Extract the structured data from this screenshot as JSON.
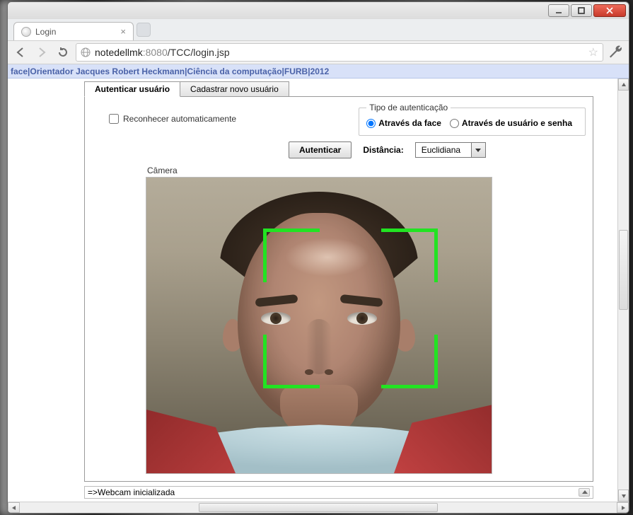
{
  "window": {
    "minimize_tooltip": "Minimize",
    "maximize_tooltip": "Maximize",
    "close_tooltip": "Close"
  },
  "browser": {
    "tab_title": "Login",
    "url_host": "notedellmk",
    "url_port": ":8080",
    "url_path": "/TCC/login.jsp"
  },
  "breadcrumb": {
    "parts": [
      "face",
      "Orientador Jacques Robert Heckmann",
      "Ciência da computação",
      "FURB",
      "2012"
    ],
    "sep": " | "
  },
  "tabs": {
    "active": "Autenticar usuário",
    "other": "Cadastrar novo usuário"
  },
  "panel": {
    "auto_rec_label": "Reconhecer automaticamente",
    "auth_type_legend": "Tipo de autenticação",
    "radio_face": "Através da face",
    "radio_userpass": "Através de usuário e senha",
    "auth_button": "Autenticar",
    "distance_label": "Distância:",
    "distance_options": [
      "Euclidiana"
    ],
    "distance_selected": "Euclidiana",
    "camera_legend": "Câmera"
  },
  "status": {
    "text": "=>Webcam inicializada"
  }
}
